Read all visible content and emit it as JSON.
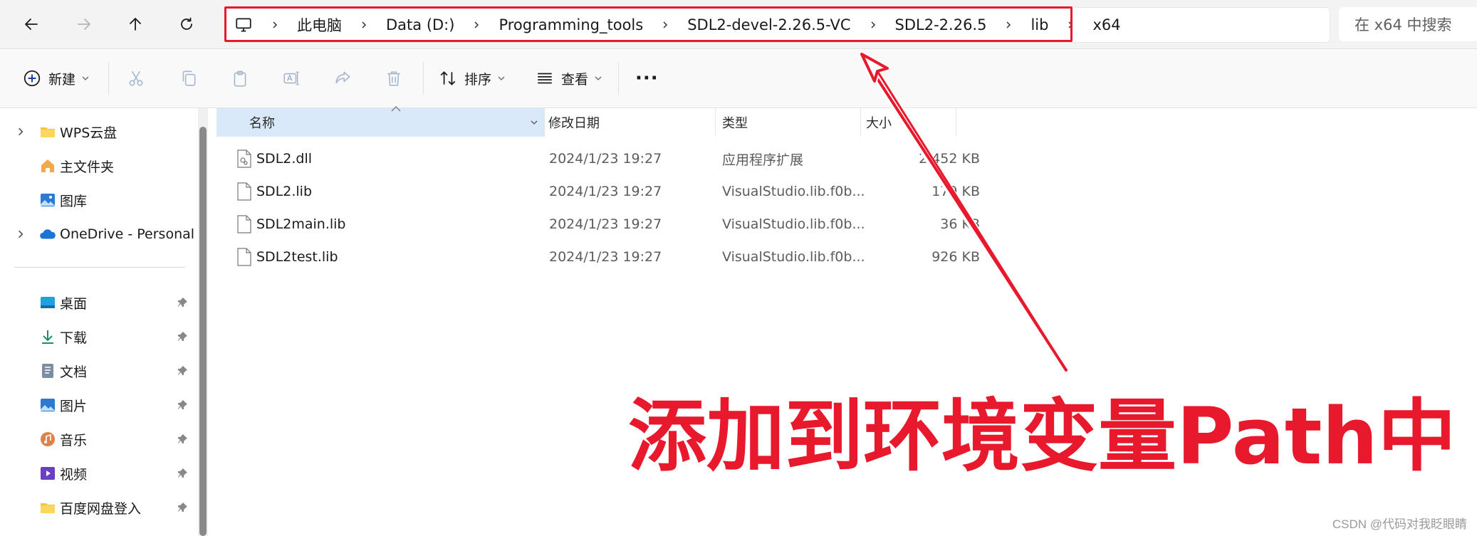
{
  "address_bar": {
    "crumbs": [
      "此电脑",
      "Data (D:)",
      "Programming_tools",
      "SDL2-devel-2.26.5-VC",
      "SDL2-2.26.5",
      "lib",
      "x64"
    ],
    "search_placeholder": "在 x64 中搜索"
  },
  "toolbar": {
    "new_label": "新建",
    "sort_label": "排序",
    "view_label": "查看",
    "more_label": "···"
  },
  "sidebar": {
    "top_items": [
      {
        "label": "WPS云盘",
        "icon": "folder-icon"
      },
      {
        "label": "主文件夹",
        "icon": "home-icon"
      },
      {
        "label": "图库",
        "icon": "gallery-icon"
      },
      {
        "label": "OneDrive - Personal",
        "icon": "cloud-icon"
      }
    ],
    "pinned_items": [
      {
        "label": "桌面",
        "icon": "desktop-icon"
      },
      {
        "label": "下载",
        "icon": "download-icon"
      },
      {
        "label": "文档",
        "icon": "document-icon"
      },
      {
        "label": "图片",
        "icon": "pictures-icon"
      },
      {
        "label": "音乐",
        "icon": "music-icon"
      },
      {
        "label": "视频",
        "icon": "video-icon"
      },
      {
        "label": "百度网盘登入",
        "icon": "folder-icon"
      }
    ]
  },
  "file_list": {
    "columns": [
      "名称",
      "修改日期",
      "类型",
      "大小"
    ],
    "rows": [
      {
        "name": "SDL2.dll",
        "date": "2024/1/23 19:27",
        "type": "应用程序扩展",
        "size": "2,452 KB",
        "icon": "dll-file-icon"
      },
      {
        "name": "SDL2.lib",
        "date": "2024/1/23 19:27",
        "type": "VisualStudio.lib.f0b...",
        "size": "179 KB",
        "icon": "file-icon"
      },
      {
        "name": "SDL2main.lib",
        "date": "2024/1/23 19:27",
        "type": "VisualStudio.lib.f0b...",
        "size": "36 KB",
        "icon": "file-icon"
      },
      {
        "name": "SDL2test.lib",
        "date": "2024/1/23 19:27",
        "type": "VisualStudio.lib.f0b...",
        "size": "926 KB",
        "icon": "file-icon"
      }
    ]
  },
  "annotation": {
    "text": "添加到环境变量Path中",
    "color": "#e8192c"
  },
  "watermark": "CSDN @代码对我眨眼睛"
}
